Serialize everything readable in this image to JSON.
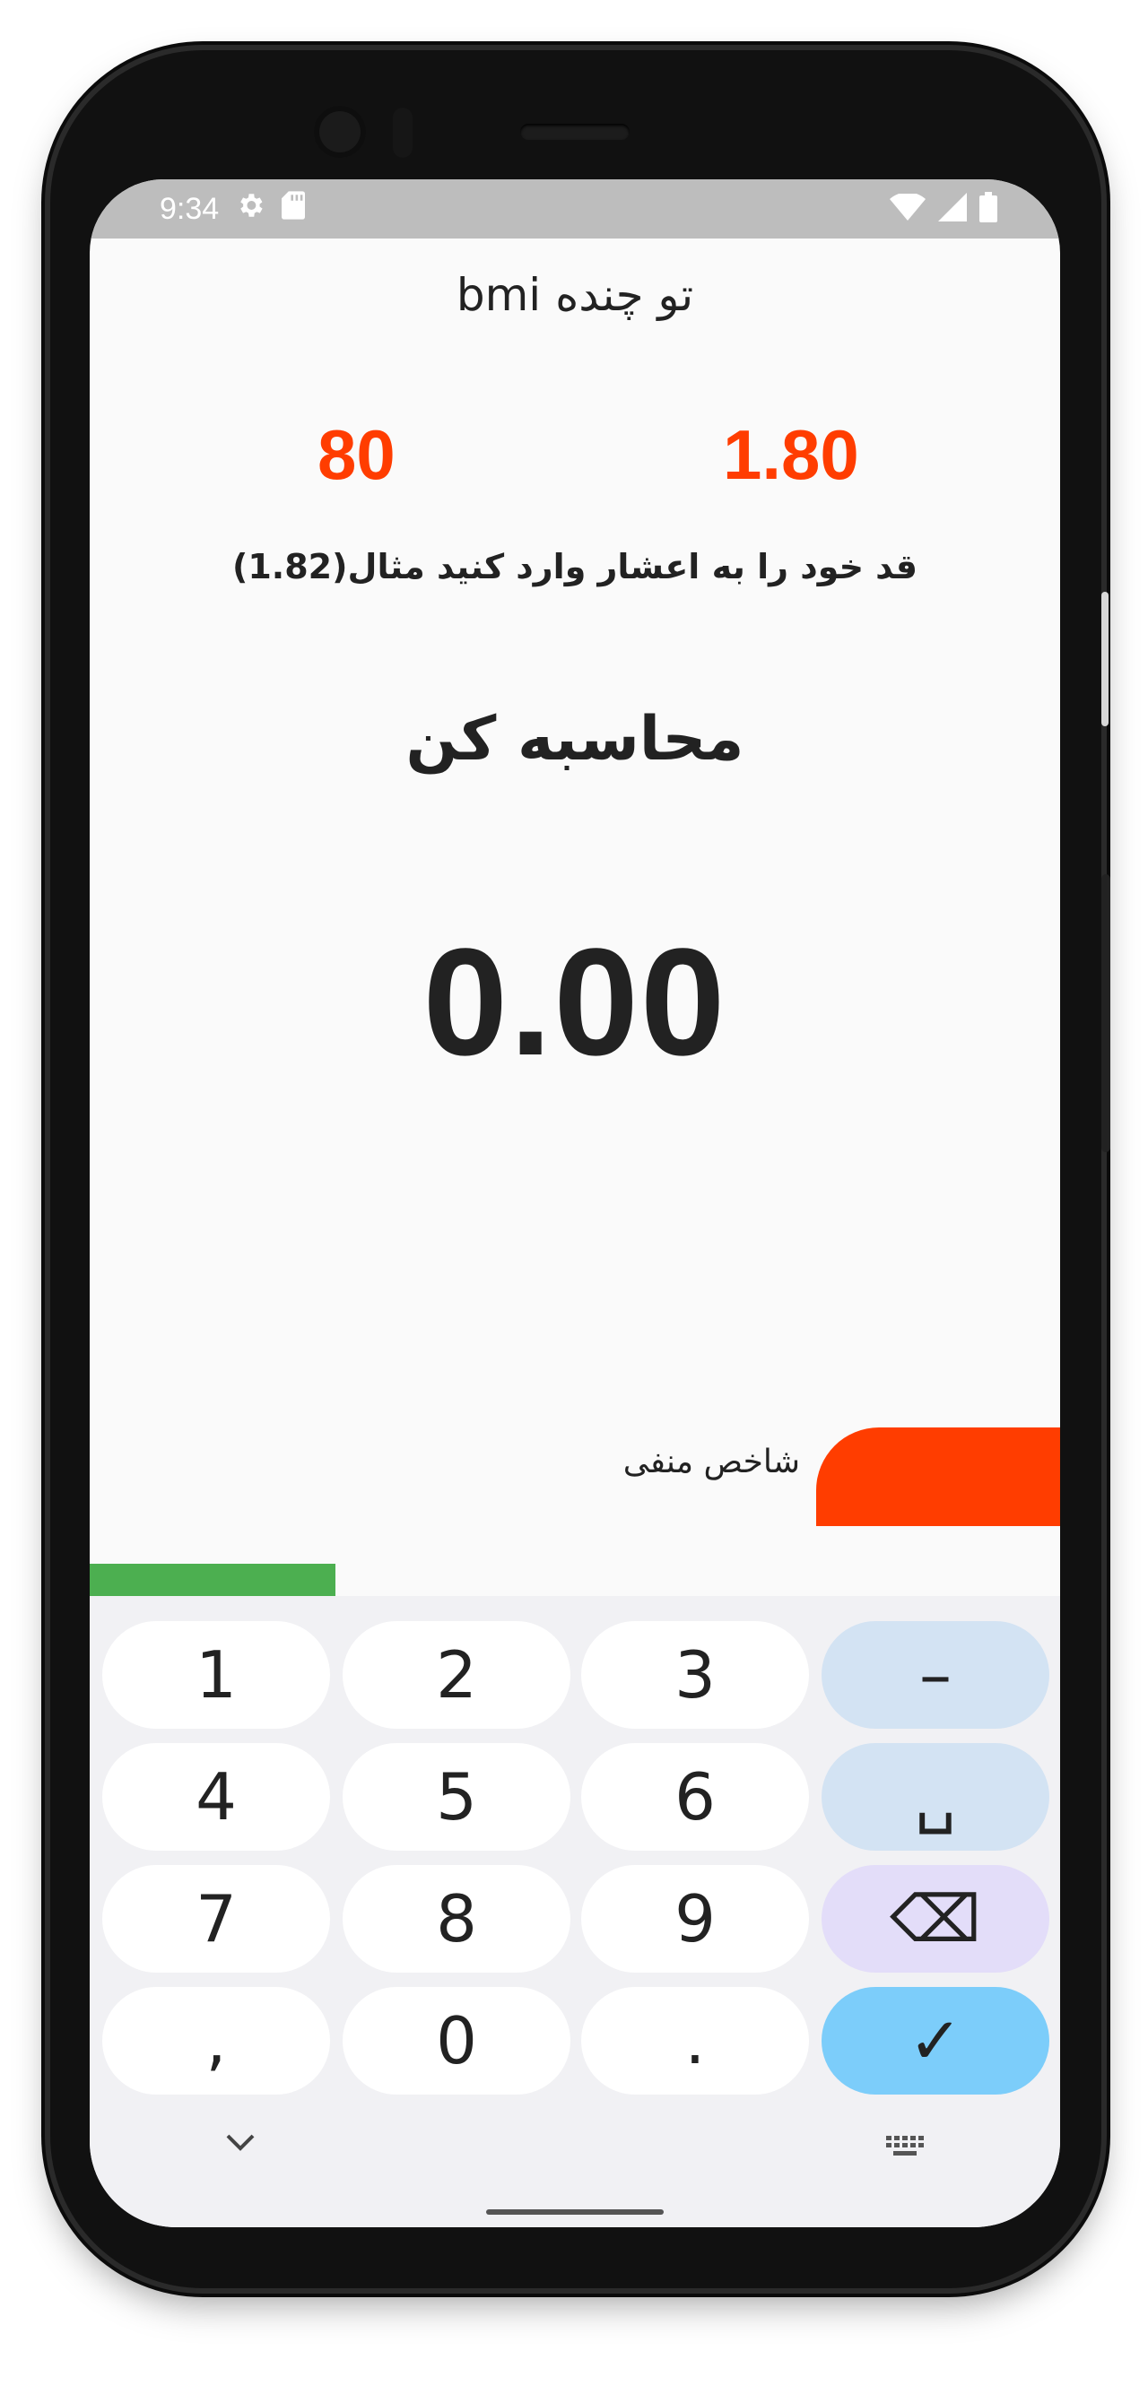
{
  "status_bar": {
    "time": "9:34",
    "icons": [
      "settings-icon",
      "sd-card-icon",
      "wifi-icon",
      "signal-icon",
      "battery-icon"
    ]
  },
  "app": {
    "title": "bmi تو چنده",
    "weight_value": "80",
    "height_value": "1.80",
    "hint": "قد خود را به اعشار وارد کنید مثال(1.82)",
    "calculate_label": "محاسبه کن",
    "result": "0.00",
    "index_label": "شاخص منفی",
    "colors": {
      "accent": "#ff3d00",
      "green": "#4caf50"
    }
  },
  "keyboard": {
    "rows": [
      [
        "1",
        "2",
        "3",
        "–"
      ],
      [
        "4",
        "5",
        "6",
        "␣"
      ],
      [
        "7",
        "8",
        "9",
        "⌫"
      ],
      [
        ",",
        "0",
        ".",
        "✓"
      ]
    ],
    "icons": [
      "chevron-down-icon",
      "keyboard-icon"
    ]
  }
}
